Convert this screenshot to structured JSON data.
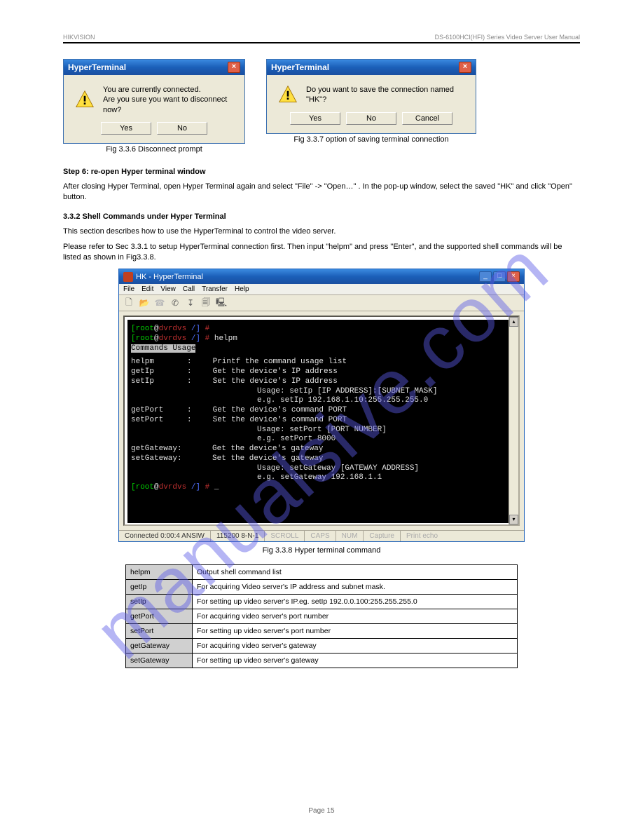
{
  "header": {
    "left": "HIKVISION",
    "right": "DS-6100HCI(HFI) Series Video Server User Manual"
  },
  "dialog1": {
    "title": "HyperTerminal",
    "msg_line1": "You are currently connected.",
    "msg_line2": "Are you sure you want to disconnect now?",
    "yes": "Yes",
    "no": "No",
    "caption": "Fig 3.3.6 Disconnect prompt"
  },
  "dialog2": {
    "title": "HyperTerminal",
    "msg": "Do you want to save the connection named \"HK\"?",
    "yes": "Yes",
    "no": "No",
    "cancel": "Cancel",
    "caption": "Fig 3.3.7 option of saving terminal connection"
  },
  "step6_head": "Step 6: re-open Hyper terminal window",
  "step6_text": "After closing Hyper Terminal, open Hyper Terminal again and select \"File\" -> \"Open…\" . In the pop-up window, select the saved \"HK\" and click \"Open\" button.",
  "s332_head": "3.3.2 Shell Commands under Hyper Terminal",
  "s332_text": "This section describes how to use the HyperTerminal to control the video server.",
  "s332_text2": "Please refer to Sec 3.3.1 to setup HyperTerminal connection first. Then input \"helpm\" and press \"Enter\", and the supported shell commands will be listed as shown in Fig3.3.8.",
  "ht": {
    "title": "HK - HyperTerminal",
    "menu": [
      "File",
      "Edit",
      "View",
      "Call",
      "Transfer",
      "Help"
    ],
    "status": [
      "Connected 0:00:4 ANSIW",
      "115200 8-N-1",
      "SCROLL",
      "CAPS",
      "NUM",
      "Capture",
      "Print echo"
    ],
    "t": {
      "l1_user": "[root",
      "l1_at": "@",
      "l1_host": "dvrdvs",
      "l1_path": " /]",
      "l1_hash": " # ",
      "l2_cmd": "helpm",
      "l3": "Commands Usage",
      "r1a": "helpm",
      "r1c": ":",
      "r1b": "Printf the command usage list",
      "r2a": "getIp",
      "r2c": ":",
      "r2b": "Get the device's IP address",
      "r3a": "setIp",
      "r3c": ":",
      "r3b": "Set the device's IP address",
      "r3u": "Usage: setIp [IP ADDRESS]:[SUBNET MASK]",
      "r3e": "e.g. setIp 192.168.1.10:255.255.255.0",
      "r4a": "getPort",
      "r4c": ":",
      "r4b": "Get the device's command PORT",
      "r5a": "setPort",
      "r5c": ":",
      "r5b": "Set the device's command PORT",
      "r5u": "Usage: setPort [PORT NUMBER]",
      "r5e": "e.g. setPort 8000",
      "r6a": "getGateway:",
      "r6b": "Get the device's gateway",
      "r7a": "setGateway:",
      "r7b": "Set the device's gateway",
      "r7u": "Usage: setGateway [GATEWAY ADDRESS]",
      "r7e": "e.g. setGateway 192.168.1.1"
    }
  },
  "fig338": "Fig 3.3.8 Hyper terminal command",
  "cmds_table": {
    "r1k": "helpm",
    "r1v": "Output shell command list",
    "r2k": "getIp",
    "r2v": "For acquiring Video server's IP address and subnet mask.",
    "r3k": "setIp",
    "r3v": "For setting up video server's IP.eg. setIp 192.0.0.100:255.255.255.0",
    "r4k": "getPort",
    "r4v": "For acquiring video server's port number",
    "r5k": "setPort",
    "r5v": "For setting up video server's port number",
    "r6k": "getGateway",
    "r6v": "For acquiring video server's gateway",
    "r7k": "setGateway",
    "r7v": "For setting up video server's gateway"
  },
  "footer": "Page 15",
  "watermark": "manualsive.com"
}
